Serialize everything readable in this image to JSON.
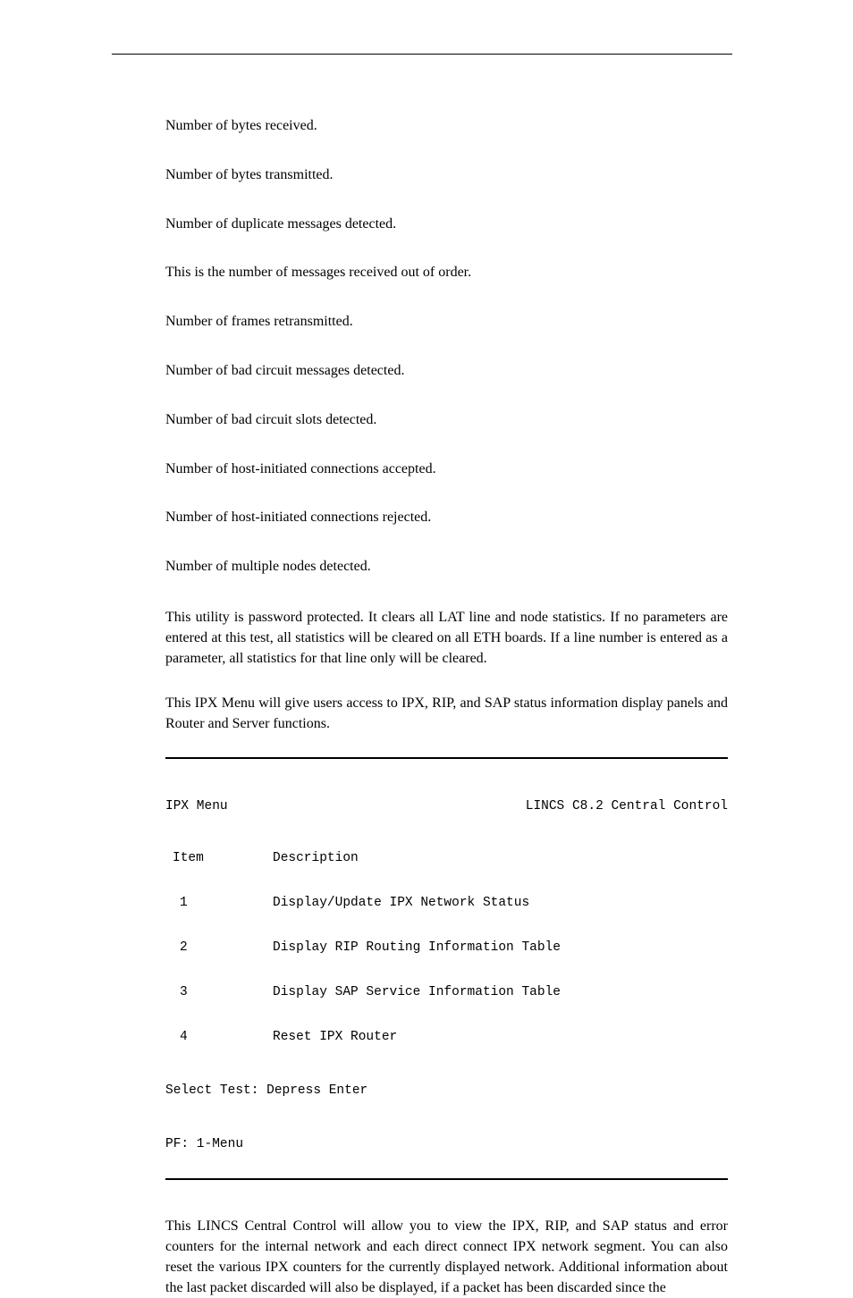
{
  "paragraphs": {
    "p1": "Number of bytes received.",
    "p2": "Number of bytes transmitted.",
    "p3": "Number of duplicate messages detected.",
    "p4": "This is the number of messages received out of order.",
    "p5": "Number of frames retransmitted.",
    "p6": "Number of bad circuit messages detected.",
    "p7": "Number of bad circuit slots detected.",
    "p8": "Number of host-initiated connections accepted.",
    "p9": "Number of host-initiated connections rejected.",
    "p10": "Number of multiple nodes detected.",
    "p11": "This utility is password protected. It clears all LAT line and node statistics. If no parameters are entered at this test, all statistics will be cleared on all ETH boards. If a line number is entered as a parameter, all statistics for that line only will be cleared.",
    "p12": "This IPX Menu will give users access to IPX, RIP, and SAP status information display panels and Router and Server functions.",
    "p13": "This LINCS Central Control will allow you to view the IPX, RIP, and SAP status and error counters for the internal network and each direct connect IPX network segment. You can also reset the various IPX counters for the currently displayed network. Additional information about the last packet discarded will also be displayed, if a packet has been discarded since the"
  },
  "terminal": {
    "title_left": "IPX Menu",
    "title_right": "LINCS C8.2 Central Control",
    "col_item": "Item",
    "col_desc": "Description",
    "rows": [
      {
        "item": "1",
        "desc": "Display/Update IPX Network Status"
      },
      {
        "item": "2",
        "desc": "Display RIP Routing Information Table"
      },
      {
        "item": "3",
        "desc": "Display SAP Service Information Table"
      },
      {
        "item": "4",
        "desc": "Reset IPX Router"
      }
    ],
    "select": "Select Test: Depress Enter",
    "pf": "PF: 1-Menu"
  }
}
